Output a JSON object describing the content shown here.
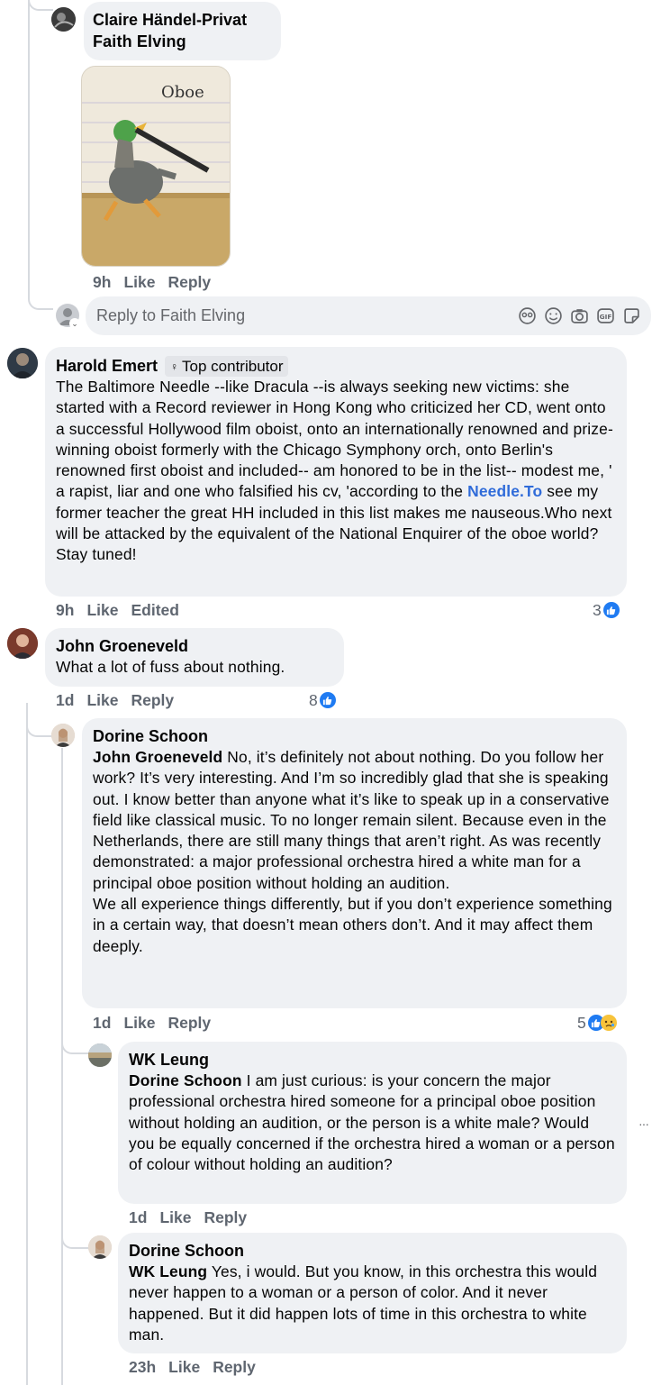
{
  "thread": {
    "c1": {
      "author": "Claire Händel-Privat",
      "text": "Faith Elving",
      "image_caption": "Oboe",
      "time": "9h",
      "like": "Like",
      "reply": "Reply"
    },
    "reply_box": {
      "placeholder": "Reply to Faith Elving",
      "icons": [
        "avatar-sticker-icon",
        "emoji-icon",
        "camera-icon",
        "gif-icon",
        "sticker-icon"
      ]
    },
    "c2": {
      "author": "Harold Emert",
      "badge": "Top contributor",
      "text_before_link": "The Baltimore Needle --like Dracula --is always seeking new victims: she started with a Record reviewer in Hong Kong who criticized her CD, went onto a successful Hollywood film oboist, onto an internationally renowned and prize- winning oboist formerly with the Chicago Symphony orch, onto Berlin's renowned first oboist and included-- am honored to be in the list-- modest me, ' a rapist, liar and one who falsified his cv, 'according to the ",
      "link": "Needle.To",
      "text_after_link": " see my former teacher the great HH included in this list makes me nauseous.Who next will be attacked by the equivalent of the National Enquirer of the oboe world?Stay tuned!",
      "time": "9h",
      "like": "Like",
      "edited": "Edited",
      "reactions": "3"
    },
    "c3": {
      "author": "John Groeneveld",
      "text": "What a lot of fuss about nothing.",
      "time": "1d",
      "like": "Like",
      "reply": "Reply",
      "reactions": "8"
    },
    "c4": {
      "author": "Dorine Schoon",
      "mention": "John Groeneveld",
      "text": " No, it’s definitely not about nothing. Do you follow her work? It’s very interesting. And I’m so incredibly glad that she is speaking out. I know better than anyone what it’s like to speak up in a conservative field like classical music. To no longer remain silent. Because even in the Netherlands, there are still many things that aren’t right. As was recently demonstrated: a major professional orchestra hired a white man for a principal oboe position without holding an audition.",
      "text2": "We all experience things differently, but if you don’t experience something in a certain way, that doesn’t mean others don’t. And it may affect them deeply.",
      "time": "1d",
      "like": "Like",
      "reply": "Reply",
      "reactions": "5"
    },
    "c5": {
      "author": "WK Leung",
      "mention": "Dorine Schoon",
      "text": " I am just curious: is your concern the major professional orchestra hired someone for a principal oboe position without holding an audition, or the person is a white male? Would you be equally concerned if the orchestra hired a woman or a person of colour without holding an audition?",
      "time": "1d",
      "like": "Like",
      "reply": "Reply",
      "more": "···"
    },
    "c6": {
      "author": "Dorine Schoon",
      "mention": "WK Leung",
      "text": " Yes, i would. But you know, in this orchestra this would never happen to a woman or a person of color. And it never happened. But it did happen lots of time in this orchestra to white man.",
      "time": "23h",
      "like": "Like",
      "reply": "Reply"
    }
  },
  "colors": {
    "bubble": "#eff1f4",
    "meta": "#5f6670",
    "link": "#2f6bd9",
    "like_blue": "#1f7bf2"
  }
}
